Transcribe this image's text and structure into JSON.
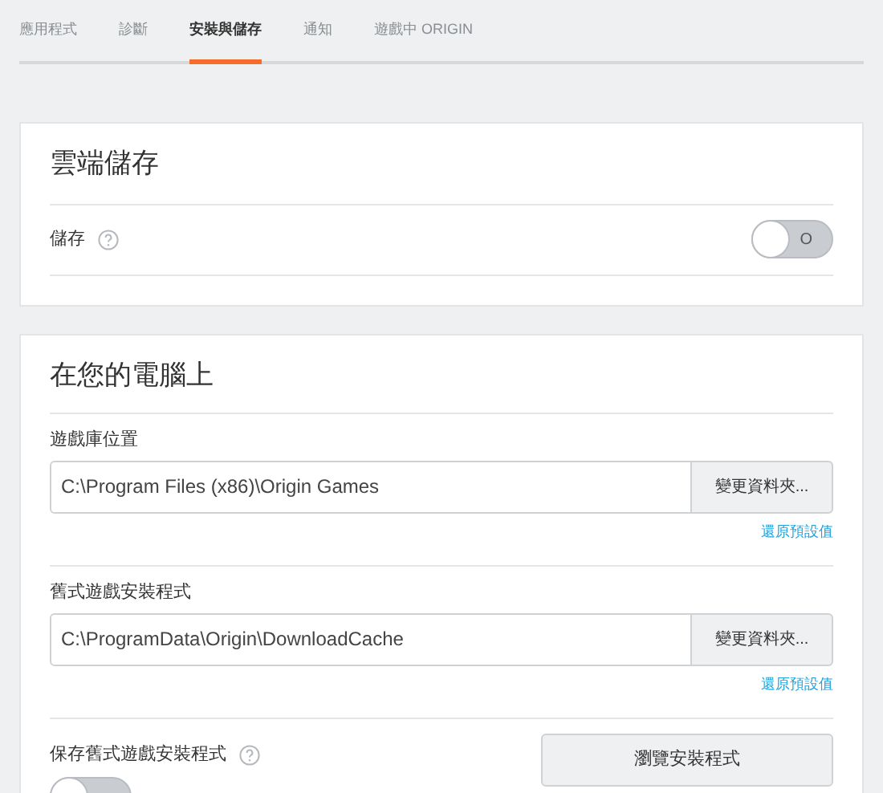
{
  "tabs": [
    {
      "label": "應用程式",
      "selected": false
    },
    {
      "label": "診斷",
      "selected": false
    },
    {
      "label": "安裝與儲存",
      "selected": true
    },
    {
      "label": "通知",
      "selected": false
    },
    {
      "label": "遊戲中 ORIGIN",
      "selected": false
    }
  ],
  "cloud": {
    "title": "雲端儲存",
    "setting": {
      "label": "儲存",
      "on": false,
      "off_label": "O"
    }
  },
  "computer": {
    "title": "在您的電腦上",
    "folders": [
      {
        "label": "遊戲庫位置",
        "value": "C:\\Program Files (x86)\\Origin Games",
        "button": "變更資料夾...",
        "reset": "還原預設值"
      },
      {
        "label": "舊式遊戲安裝程式",
        "value": "C:\\ProgramData\\Origin\\DownloadCache",
        "button": "變更資料夾...",
        "reset": "還原預設值"
      }
    ],
    "keep": {
      "label": "保存舊式遊戲安裝程式",
      "button": "瀏覽安裝程式",
      "on": false
    }
  }
}
